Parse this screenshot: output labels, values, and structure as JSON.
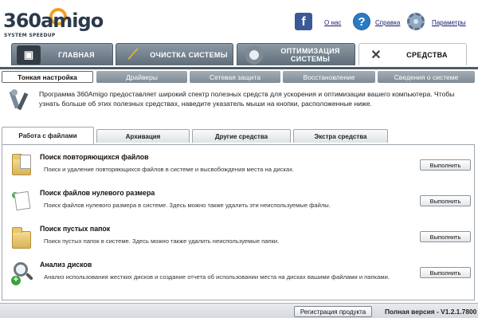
{
  "app": {
    "logo_main": "360amigo",
    "logo_sub": "SYSTEM SPEEDUP"
  },
  "header_links": {
    "facebook_icon": "facebook-icon",
    "about": "О нас",
    "help": "Справка",
    "settings": "Параметры"
  },
  "main_tabs": [
    {
      "label": "ГЛАВНАЯ",
      "icon": "home-monitor-icon"
    },
    {
      "label": "ОЧИСТКА СИСТЕМЫ",
      "icon": "broom-icon"
    },
    {
      "label": "ОПТИМИЗАЦИЯ СИСТЕМЫ",
      "icon": "gear-icon"
    },
    {
      "label": "СРЕДСТВА",
      "icon": "tools-icon",
      "active": true
    }
  ],
  "sub_tabs": [
    {
      "label": "Тонкая настройка",
      "active": true
    },
    {
      "label": "Драйверы"
    },
    {
      "label": "Сетевая защита"
    },
    {
      "label": "Восстановление"
    },
    {
      "label": "Сведения о системе"
    }
  ],
  "info": {
    "text": "Программа 360Amigo предоставляет широкий спектр полезных средств для ускорения и оптимизации вашего компьютера. Чтобы узнать больше об этих полезных средствах, наведите указатель мыши на кнопки, расположенные ниже."
  },
  "section_tabs": [
    {
      "label": "Работа с файлами",
      "active": true
    },
    {
      "label": "Архивация"
    },
    {
      "label": "Другие средства"
    },
    {
      "label": "Экстра средства"
    }
  ],
  "tools": [
    {
      "title": "Поиск повторяющихся файлов",
      "desc": "Поиск и удаление повторяющихся файлов в системе и высвобождения места на дисках.",
      "button": "Выполнить"
    },
    {
      "title": "Поиск файлов нулевого размера",
      "desc": "Поиск файлов нулевого размера в системе. Здесь можно также удалить эти неиспользуемые файлы.",
      "button": "Выполнить"
    },
    {
      "title": "Поиск пустых папок",
      "desc": "Поиск пустых папок в системе. Здесь можно также удалить неиспользуемые папки.",
      "button": "Выполнить"
    },
    {
      "title": "Анализ дисков",
      "desc": "Анализ использования жестких дисков и создание отчета об использовании места на дисках вашими файлами и папками.",
      "button": "Выполнить"
    }
  ],
  "status": {
    "register_button": "Регистрация продукта",
    "version": "Полная версия  - V1.2.1.7800"
  },
  "colors": {
    "tab_dark": "#5e6d79",
    "facebook": "#3b5998",
    "help": "#2a7bc4",
    "logo_ring": "#f0a020"
  }
}
